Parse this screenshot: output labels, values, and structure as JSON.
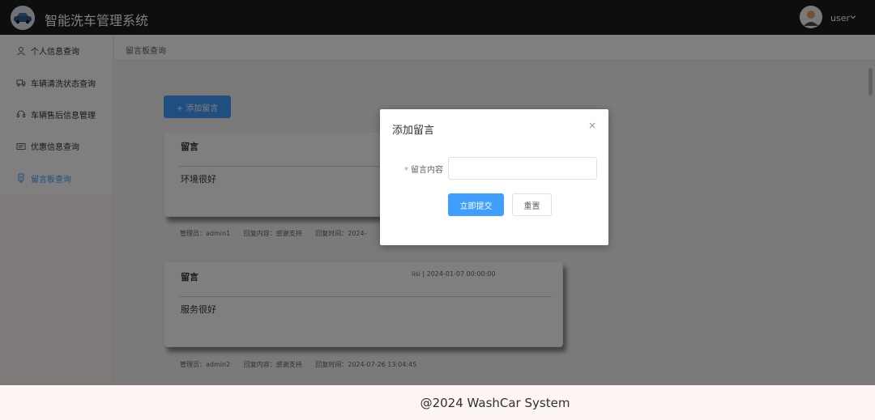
{
  "header": {
    "title": "智能洗车管理系统",
    "user_name": "user",
    "logo_icon": "car-logo-icon",
    "avatar_icon": "user-avatar-icon"
  },
  "sidebar": {
    "items": [
      {
        "label": "个人信息查询",
        "icon": "user-icon",
        "active": false
      },
      {
        "label": "车辆清洗状态查询",
        "icon": "truck-icon",
        "active": false
      },
      {
        "label": "车辆售后信息管理",
        "icon": "headset-icon",
        "active": false
      },
      {
        "label": "优惠信息查询",
        "icon": "coupon-icon",
        "active": false
      },
      {
        "label": "留言板查询",
        "icon": "message-icon",
        "active": true
      }
    ]
  },
  "breadcrumb": "留言板查询",
  "main": {
    "add_button_label": "+ 添加留言",
    "messages": [
      {
        "title": "留言",
        "meta": "",
        "content": "环境很好",
        "reply_admin": "管理员：admin1",
        "reply_content": "回复内容：感谢支持",
        "reply_time": "回复时间：2024-"
      },
      {
        "title": "留言",
        "meta": "lisi | 2024-01-07 00:00:00",
        "content": "服务很好",
        "reply_admin": "管理员：admin2",
        "reply_content": "回复内容：感谢支持",
        "reply_time": "回复时间：2024-07-26 13:04:45"
      }
    ]
  },
  "dialog": {
    "title": "添加留言",
    "field_label": "留言内容",
    "field_required_mark": "*",
    "field_value": "",
    "submit_label": "立即提交",
    "reset_label": "重置"
  },
  "footer": {
    "text": "@2024 WashCar System"
  },
  "colors": {
    "primary": "#409eff",
    "header_bg": "#1d1d1d",
    "divider": "#a8e6c9"
  }
}
